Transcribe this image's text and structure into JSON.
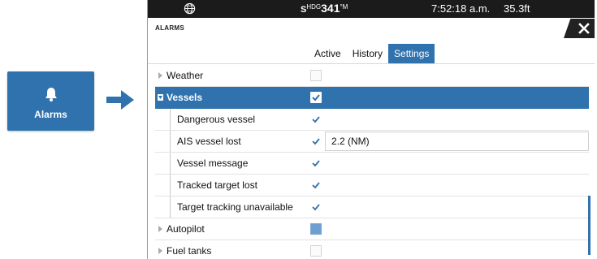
{
  "tile": {
    "label": "Alarms",
    "icon": "bell-icon"
  },
  "status": {
    "hdg_prefix": "S",
    "hdg_small": "HDG",
    "hdg_value": "341",
    "hdg_unit": "°M",
    "time": "7:52:18 a.m.",
    "depth": "35.3ft"
  },
  "window": {
    "title": "ALARMS",
    "close_icon": "close-icon"
  },
  "tabs": [
    "Active",
    "History",
    "Settings"
  ],
  "selected_tab": "Settings",
  "rows": [
    {
      "label": "Weather"
    },
    {
      "label": "Vessels"
    },
    {
      "label": "Dangerous vessel"
    },
    {
      "label": "AIS vessel lost",
      "value": "2.2 (NM)"
    },
    {
      "label": "Vessel message"
    },
    {
      "label": "Tracked target lost"
    },
    {
      "label": "Target tracking unavailable"
    },
    {
      "label": "Autopilot"
    },
    {
      "label": "Fuel tanks"
    }
  ],
  "colors": {
    "accent": "#2f72ad",
    "statusbar": "#1b1b1b",
    "check": "#2f72ad"
  }
}
